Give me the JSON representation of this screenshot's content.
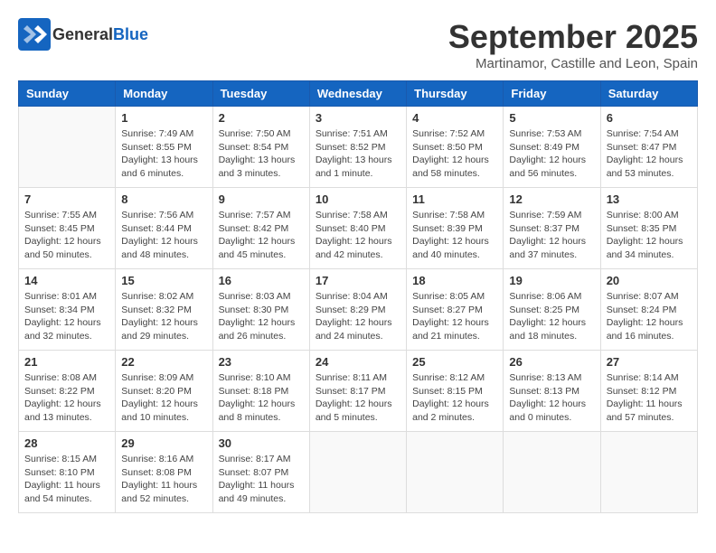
{
  "logo": {
    "general": "General",
    "blue": "Blue"
  },
  "title": "September 2025",
  "subtitle": "Martinamor, Castille and Leon, Spain",
  "days_of_week": [
    "Sunday",
    "Monday",
    "Tuesday",
    "Wednesday",
    "Thursday",
    "Friday",
    "Saturday"
  ],
  "weeks": [
    [
      {
        "day": "",
        "info": ""
      },
      {
        "day": "1",
        "info": "Sunrise: 7:49 AM\nSunset: 8:55 PM\nDaylight: 13 hours\nand 6 minutes."
      },
      {
        "day": "2",
        "info": "Sunrise: 7:50 AM\nSunset: 8:54 PM\nDaylight: 13 hours\nand 3 minutes."
      },
      {
        "day": "3",
        "info": "Sunrise: 7:51 AM\nSunset: 8:52 PM\nDaylight: 13 hours\nand 1 minute."
      },
      {
        "day": "4",
        "info": "Sunrise: 7:52 AM\nSunset: 8:50 PM\nDaylight: 12 hours\nand 58 minutes."
      },
      {
        "day": "5",
        "info": "Sunrise: 7:53 AM\nSunset: 8:49 PM\nDaylight: 12 hours\nand 56 minutes."
      },
      {
        "day": "6",
        "info": "Sunrise: 7:54 AM\nSunset: 8:47 PM\nDaylight: 12 hours\nand 53 minutes."
      }
    ],
    [
      {
        "day": "7",
        "info": "Sunrise: 7:55 AM\nSunset: 8:45 PM\nDaylight: 12 hours\nand 50 minutes."
      },
      {
        "day": "8",
        "info": "Sunrise: 7:56 AM\nSunset: 8:44 PM\nDaylight: 12 hours\nand 48 minutes."
      },
      {
        "day": "9",
        "info": "Sunrise: 7:57 AM\nSunset: 8:42 PM\nDaylight: 12 hours\nand 45 minutes."
      },
      {
        "day": "10",
        "info": "Sunrise: 7:58 AM\nSunset: 8:40 PM\nDaylight: 12 hours\nand 42 minutes."
      },
      {
        "day": "11",
        "info": "Sunrise: 7:58 AM\nSunset: 8:39 PM\nDaylight: 12 hours\nand 40 minutes."
      },
      {
        "day": "12",
        "info": "Sunrise: 7:59 AM\nSunset: 8:37 PM\nDaylight: 12 hours\nand 37 minutes."
      },
      {
        "day": "13",
        "info": "Sunrise: 8:00 AM\nSunset: 8:35 PM\nDaylight: 12 hours\nand 34 minutes."
      }
    ],
    [
      {
        "day": "14",
        "info": "Sunrise: 8:01 AM\nSunset: 8:34 PM\nDaylight: 12 hours\nand 32 minutes."
      },
      {
        "day": "15",
        "info": "Sunrise: 8:02 AM\nSunset: 8:32 PM\nDaylight: 12 hours\nand 29 minutes."
      },
      {
        "day": "16",
        "info": "Sunrise: 8:03 AM\nSunset: 8:30 PM\nDaylight: 12 hours\nand 26 minutes."
      },
      {
        "day": "17",
        "info": "Sunrise: 8:04 AM\nSunset: 8:29 PM\nDaylight: 12 hours\nand 24 minutes."
      },
      {
        "day": "18",
        "info": "Sunrise: 8:05 AM\nSunset: 8:27 PM\nDaylight: 12 hours\nand 21 minutes."
      },
      {
        "day": "19",
        "info": "Sunrise: 8:06 AM\nSunset: 8:25 PM\nDaylight: 12 hours\nand 18 minutes."
      },
      {
        "day": "20",
        "info": "Sunrise: 8:07 AM\nSunset: 8:24 PM\nDaylight: 12 hours\nand 16 minutes."
      }
    ],
    [
      {
        "day": "21",
        "info": "Sunrise: 8:08 AM\nSunset: 8:22 PM\nDaylight: 12 hours\nand 13 minutes."
      },
      {
        "day": "22",
        "info": "Sunrise: 8:09 AM\nSunset: 8:20 PM\nDaylight: 12 hours\nand 10 minutes."
      },
      {
        "day": "23",
        "info": "Sunrise: 8:10 AM\nSunset: 8:18 PM\nDaylight: 12 hours\nand 8 minutes."
      },
      {
        "day": "24",
        "info": "Sunrise: 8:11 AM\nSunset: 8:17 PM\nDaylight: 12 hours\nand 5 minutes."
      },
      {
        "day": "25",
        "info": "Sunrise: 8:12 AM\nSunset: 8:15 PM\nDaylight: 12 hours\nand 2 minutes."
      },
      {
        "day": "26",
        "info": "Sunrise: 8:13 AM\nSunset: 8:13 PM\nDaylight: 12 hours\nand 0 minutes."
      },
      {
        "day": "27",
        "info": "Sunrise: 8:14 AM\nSunset: 8:12 PM\nDaylight: 11 hours\nand 57 minutes."
      }
    ],
    [
      {
        "day": "28",
        "info": "Sunrise: 8:15 AM\nSunset: 8:10 PM\nDaylight: 11 hours\nand 54 minutes."
      },
      {
        "day": "29",
        "info": "Sunrise: 8:16 AM\nSunset: 8:08 PM\nDaylight: 11 hours\nand 52 minutes."
      },
      {
        "day": "30",
        "info": "Sunrise: 8:17 AM\nSunset: 8:07 PM\nDaylight: 11 hours\nand 49 minutes."
      },
      {
        "day": "",
        "info": ""
      },
      {
        "day": "",
        "info": ""
      },
      {
        "day": "",
        "info": ""
      },
      {
        "day": "",
        "info": ""
      }
    ]
  ]
}
